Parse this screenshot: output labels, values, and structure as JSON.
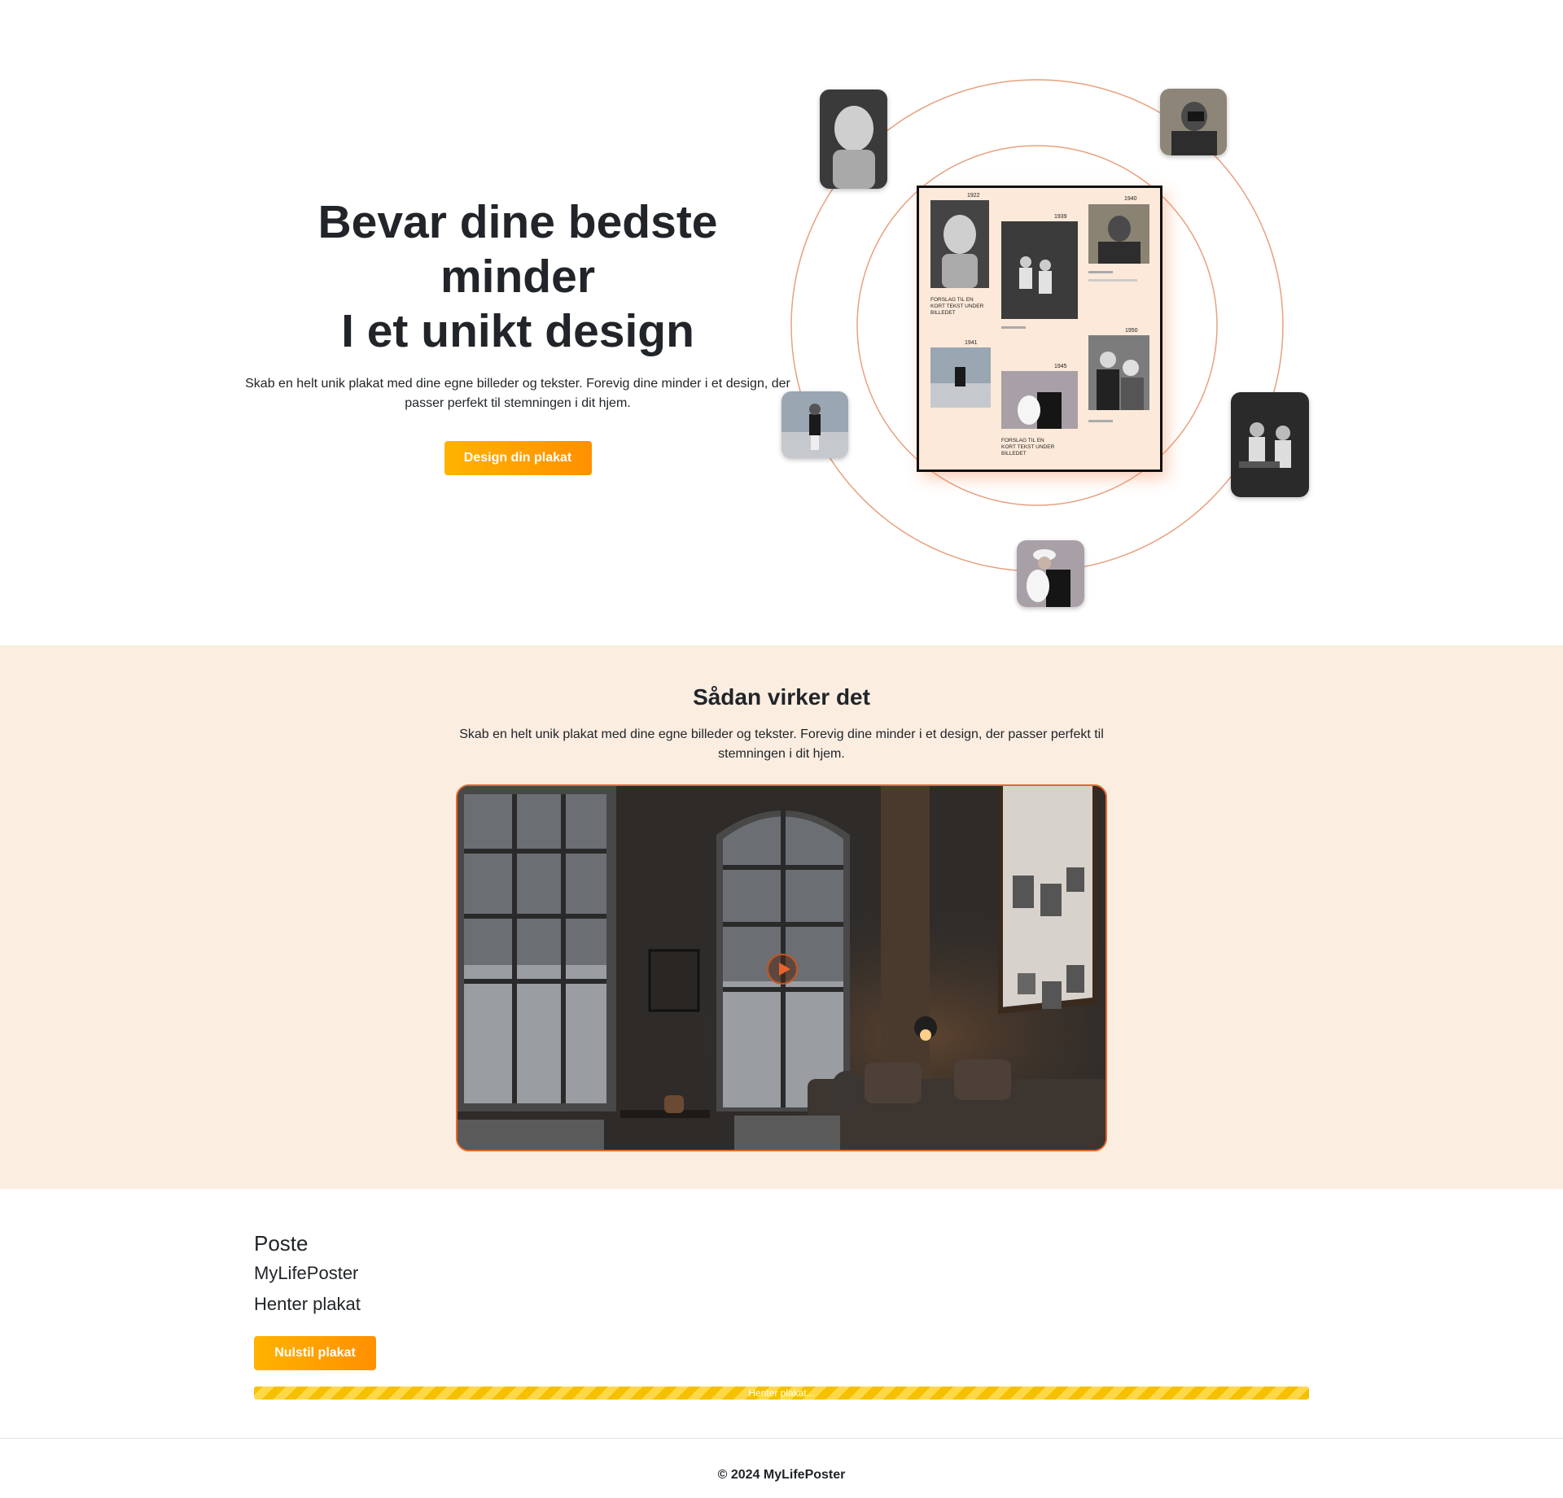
{
  "hero": {
    "title_lines": [
      "Bevar dine bedste",
      "minder",
      "I et unikt design"
    ],
    "subtitle": "Skab en helt unik plakat med dine egne billeder og tekster. Forevig dine minder i et design, der passer perfekt til stemningen i dit hjem.",
    "cta_label": "Design din plakat"
  },
  "poster_preview": {
    "years": [
      "1922",
      "1939",
      "1940",
      "1941",
      "1945",
      "1950"
    ],
    "caption": "FORSLAG TIL EN KORT TEKST UNDER BILLEDET"
  },
  "how": {
    "title": "Sådan virker det",
    "subtitle": "Skab en helt unik plakat med dine egne billeder og tekster. Forevig dine minder i et design, der passer perfekt til stemningen i dit hjem."
  },
  "status": {
    "title": "Poste",
    "brand": "MyLifePoster",
    "loading": "Henter plakat",
    "reset_label": "Nulstil plakat",
    "progress_label": "Henter plakat...",
    "progress_fraction": 1.0
  },
  "footer": {
    "copyright": "© 2024 MyLifePoster"
  },
  "colors": {
    "accent": "#ff9800",
    "orbit": "#e8a080",
    "section_bg": "#fcede1",
    "video_border": "#e8642c"
  }
}
